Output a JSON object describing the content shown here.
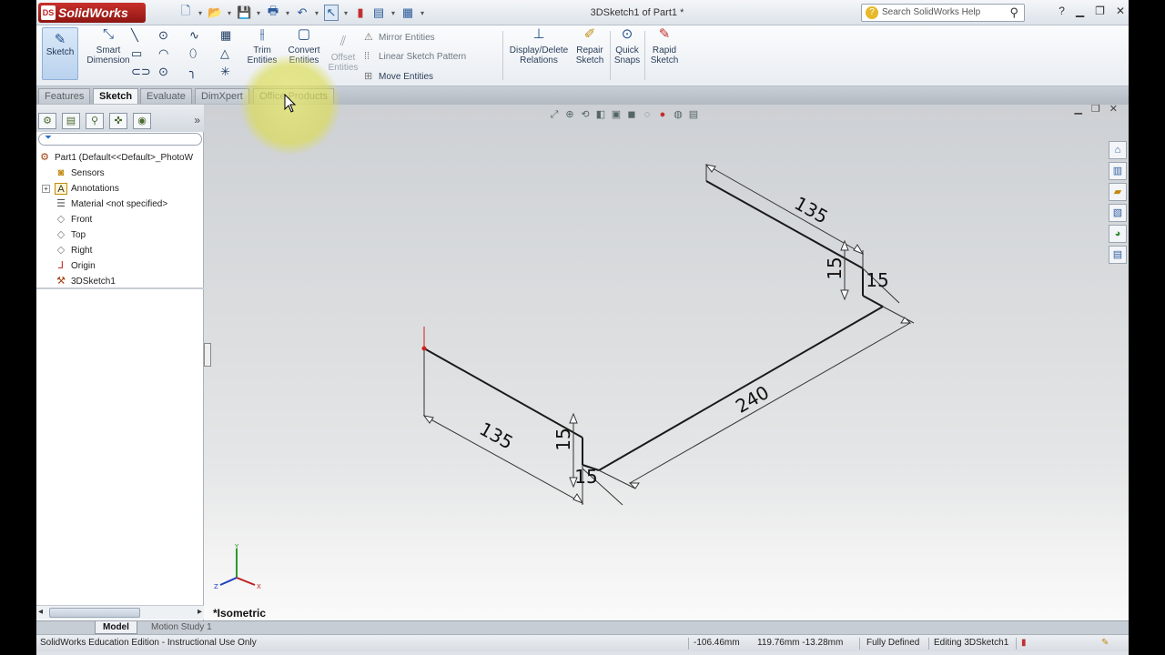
{
  "app": {
    "logo": "SolidWorks",
    "ds_mark": "DS",
    "doc_title": "3DSketch1 of Part1 *"
  },
  "search": {
    "placeholder": "Search SolidWorks Help"
  },
  "toolbar": {
    "sketch": "Sketch",
    "smart_dimension": [
      "Smart",
      "Dimension"
    ],
    "trim": [
      "Trim",
      "Entities"
    ],
    "convert": [
      "Convert",
      "Entities"
    ],
    "offset": [
      "Offset",
      "Entities"
    ],
    "mirror": "Mirror Entities",
    "linear_pattern": "Linear Sketch Pattern",
    "move": "Move Entities",
    "display_relations": [
      "Display/Delete",
      "Relations"
    ],
    "repair": [
      "Repair",
      "Sketch"
    ],
    "quick_snaps": [
      "Quick",
      "Snaps"
    ],
    "rapid_sketch": [
      "Rapid",
      "Sketch"
    ]
  },
  "tabs": [
    "Features",
    "Sketch",
    "Evaluate",
    "DimXpert",
    "Office Products"
  ],
  "feature_tree": {
    "root": "Part1  (Default<<Default>_PhotoW",
    "items": [
      "Sensors",
      "Annotations",
      "Material <not specified>",
      "Front",
      "Top",
      "Right",
      "Origin",
      "3DSketch1"
    ]
  },
  "viewport": {
    "view_name": "*Isometric",
    "dimensions": [
      "135",
      "15",
      "15",
      "240",
      "135",
      "15",
      "15"
    ],
    "triad_axes": {
      "x": "X",
      "y": "Y",
      "z": "Z"
    }
  },
  "bottom_tabs": [
    "Model",
    "Motion Study 1"
  ],
  "status": {
    "edition": "SolidWorks Education Edition - Instructional Use Only",
    "x": "-106.46mm",
    "yz": "119.76mm -13.28mm",
    "state": "Fully Defined",
    "editing": "Editing 3DSketch1"
  },
  "colors": {
    "accent": "#1e4f8a",
    "logo_red": "#b22222",
    "sketch_line": "#1a1a1a",
    "highlight": "#e6e66e"
  }
}
